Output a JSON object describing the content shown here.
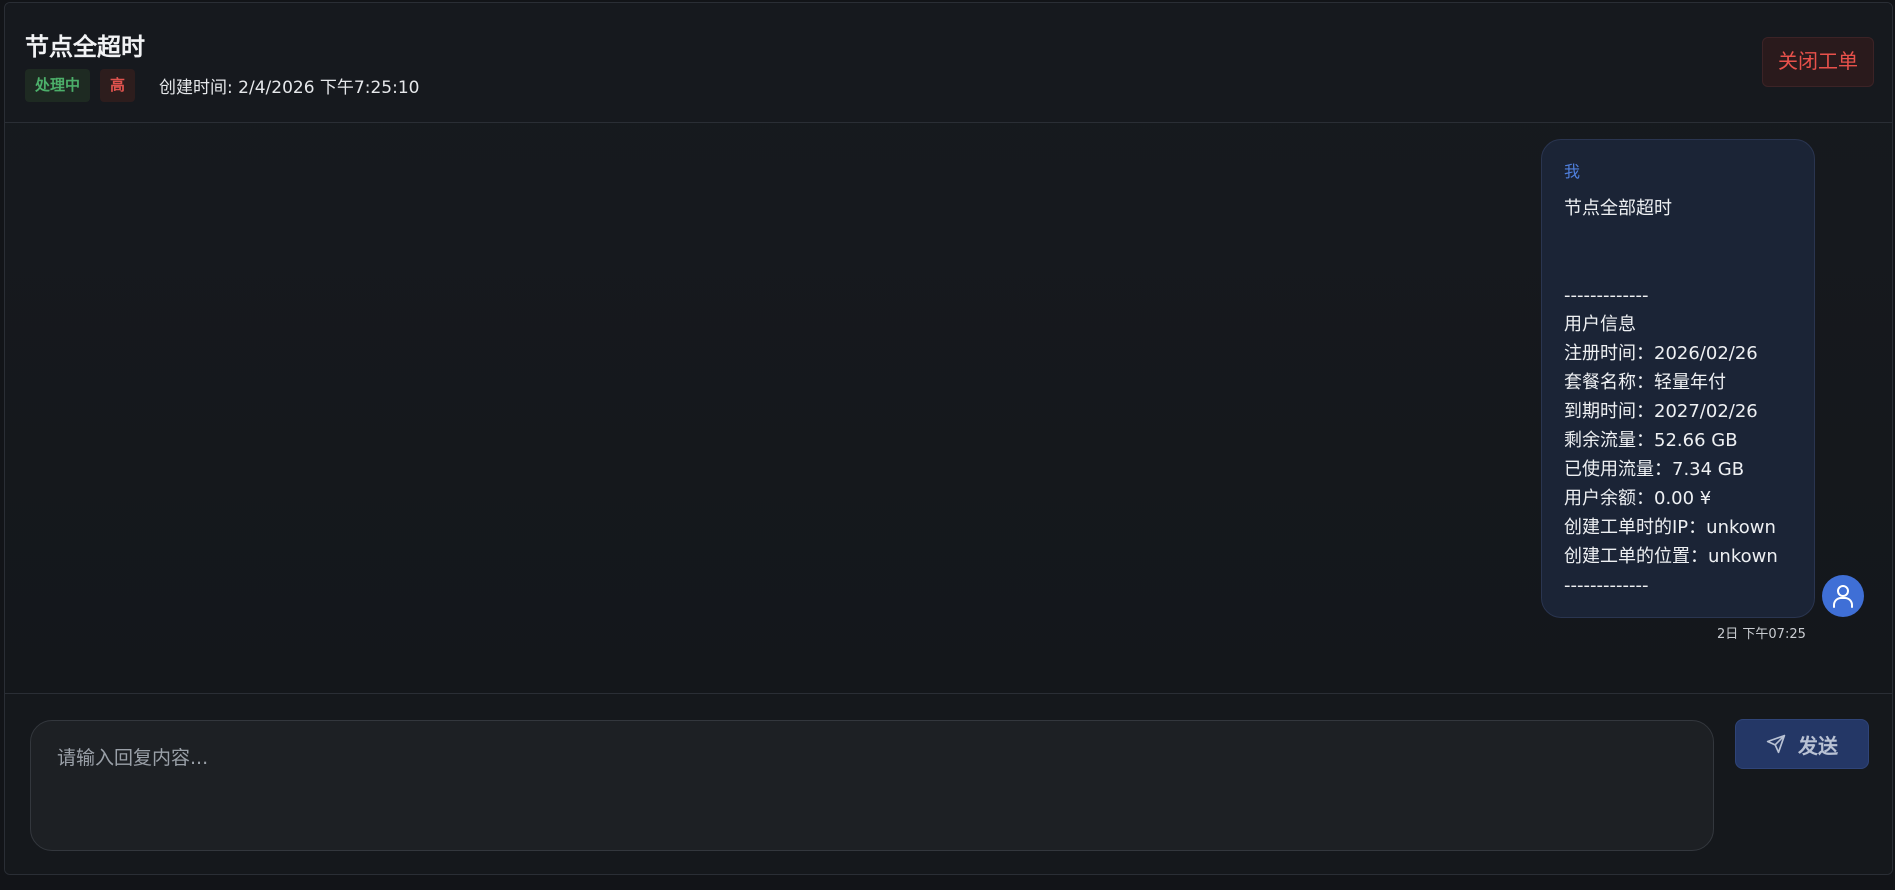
{
  "ticket": {
    "title": "节点全超时",
    "status": "处理中",
    "priority": "高",
    "created_label": "创建时间: 2/4/2026 下午7:25:10",
    "close_label": "关闭工单"
  },
  "message": {
    "sender": "我",
    "body": "节点全部超时\n\n\n-------------\n用户信息\n注册时间：2026/02/26\n套餐名称：轻量年付\n到期时间：2027/02/26\n剩余流量：52.66 GB\n已使用流量：7.34 GB\n用户余额：0.00 ¥\n创建工单时的IP：unkown\n创建工单的位置：unkown\n-------------",
    "time": "2日 下午07:25",
    "avatar_icon": "user-icon"
  },
  "composer": {
    "placeholder": "请输入回复内容...",
    "send_label": "发送",
    "send_icon": "send-icon"
  },
  "colors": {
    "accent": "#3f6fd6",
    "danger": "#e8514b",
    "success": "#4caf6a"
  }
}
